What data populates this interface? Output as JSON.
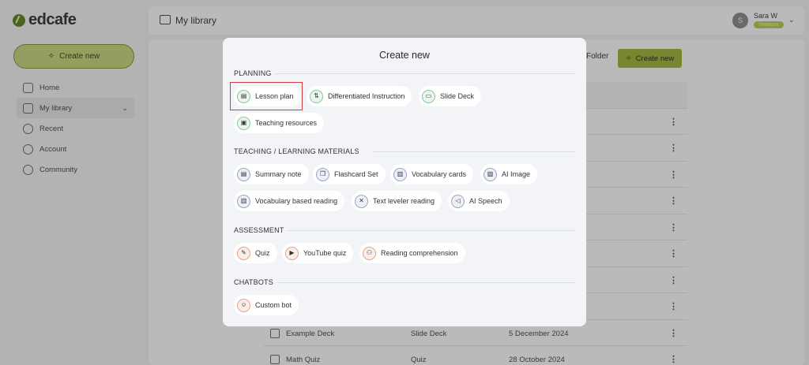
{
  "app": {
    "logo_text": "edcafe",
    "brand_color": "#5d7f1c"
  },
  "sidebar": {
    "create_label": "Create new",
    "items": [
      {
        "label": "Home",
        "icon": "home-icon"
      },
      {
        "label": "My library",
        "icon": "library-icon",
        "active": true
      },
      {
        "label": "Recent",
        "icon": "clock-icon"
      },
      {
        "label": "Account",
        "icon": "gear-icon"
      },
      {
        "label": "Community",
        "icon": "facebook-icon"
      }
    ]
  },
  "topbar": {
    "title": "My library",
    "user_initial": "S",
    "user_name": "Sara W",
    "user_badge": "Premium"
  },
  "main": {
    "folder_label": "Folder",
    "create_label": "Create new",
    "rows": [
      {
        "name": "Example Deck",
        "type": "Slide Deck",
        "date": "5 December 2024"
      },
      {
        "name": "Math Quiz",
        "type": "Quiz",
        "date": "28 October 2024"
      }
    ]
  },
  "modal": {
    "title": "Create new",
    "sections": [
      {
        "label": "PLANNING",
        "items": [
          "Lesson plan",
          "Differentiated Instruction",
          "Slide Deck",
          "Teaching resources"
        ]
      },
      {
        "label": "TEACHING / LEARNING MATERIALS",
        "items": [
          "Summary note",
          "Flashcard Set",
          "Vocabulary cards",
          "AI Image",
          "Vocabulary based reading",
          "Text leveler reading",
          "AI Speech"
        ]
      },
      {
        "label": "ASSESSMENT",
        "items": [
          "Quiz",
          "YouTube quiz",
          "Reading comprehension"
        ]
      },
      {
        "label": "CHATBOTS",
        "items": [
          "Custom bot"
        ]
      }
    ],
    "highlight_color": "#d43b3b"
  }
}
